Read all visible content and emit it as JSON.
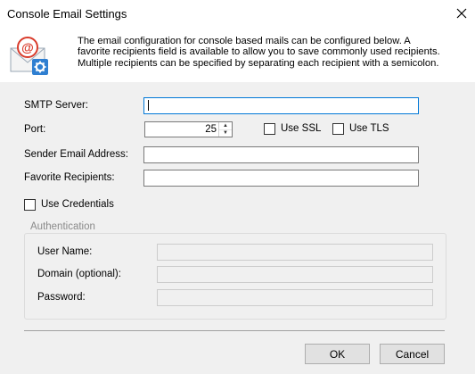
{
  "window": {
    "title": "Console Email Settings"
  },
  "header": {
    "icon": "email-settings-icon",
    "description_lines": [
      "The email configuration for console based mails can be configured below. A",
      "favorite recipients field is available to allow you to save commonly used recipients.",
      "Multiple recipients can be specified by separating each recipient with a semicolon."
    ]
  },
  "form": {
    "smtp_server": {
      "label": "SMTP Server:",
      "value": ""
    },
    "port": {
      "label": "Port:",
      "value": "25"
    },
    "use_ssl": {
      "label": "Use SSL",
      "checked": false
    },
    "use_tls": {
      "label": "Use TLS",
      "checked": false
    },
    "sender": {
      "label": "Sender Email Address:",
      "value": ""
    },
    "favorites": {
      "label": "Favorite Recipients:",
      "value": ""
    },
    "use_credentials": {
      "label": "Use Credentials",
      "checked": false
    }
  },
  "auth": {
    "title": "Authentication",
    "user_name": {
      "label": "User Name:",
      "value": ""
    },
    "domain": {
      "label": "Domain (optional):",
      "value": ""
    },
    "password": {
      "label": "Password:",
      "value": ""
    }
  },
  "buttons": {
    "ok": "OK",
    "cancel": "Cancel"
  },
  "colors": {
    "focus_border": "#0078d7",
    "dialog_bg": "#f0f0f0"
  }
}
